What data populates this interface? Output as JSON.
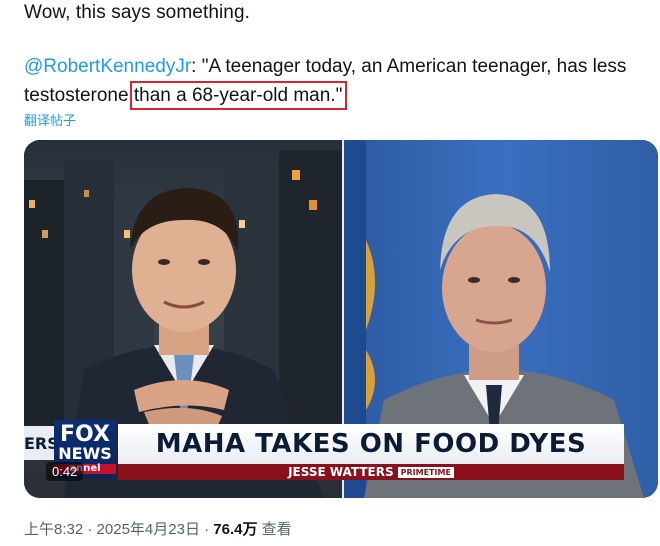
{
  "tweet": {
    "lead": "Wow, this says something.",
    "mention": "@RobertKennedyJr",
    "quote_part1": ": \"A teenager today, an American teenager, has less testosterone",
    "quote_highlight": "than a 68-year-old man.\"",
    "translate_label": "翻译帖子"
  },
  "video": {
    "headline": "MAHA TAKES ON FOOD DYES",
    "host_name": "JESSE WATTERS",
    "show_tag": "PRIMETIME",
    "logo_line1": "FOX",
    "logo_line2": "NEWS",
    "logo_line3": "annel",
    "side_tag": "ERS",
    "duration": "0:42"
  },
  "meta": {
    "time": "上午8:32",
    "sep1": " · ",
    "date": "2025年4月23日",
    "sep2": " · ",
    "views_count": "76.4万",
    "views_label": " 查看"
  },
  "colors": {
    "link": "#1d9bf0",
    "highlight_box": "#d9232e",
    "secondary_text": "#536471"
  }
}
